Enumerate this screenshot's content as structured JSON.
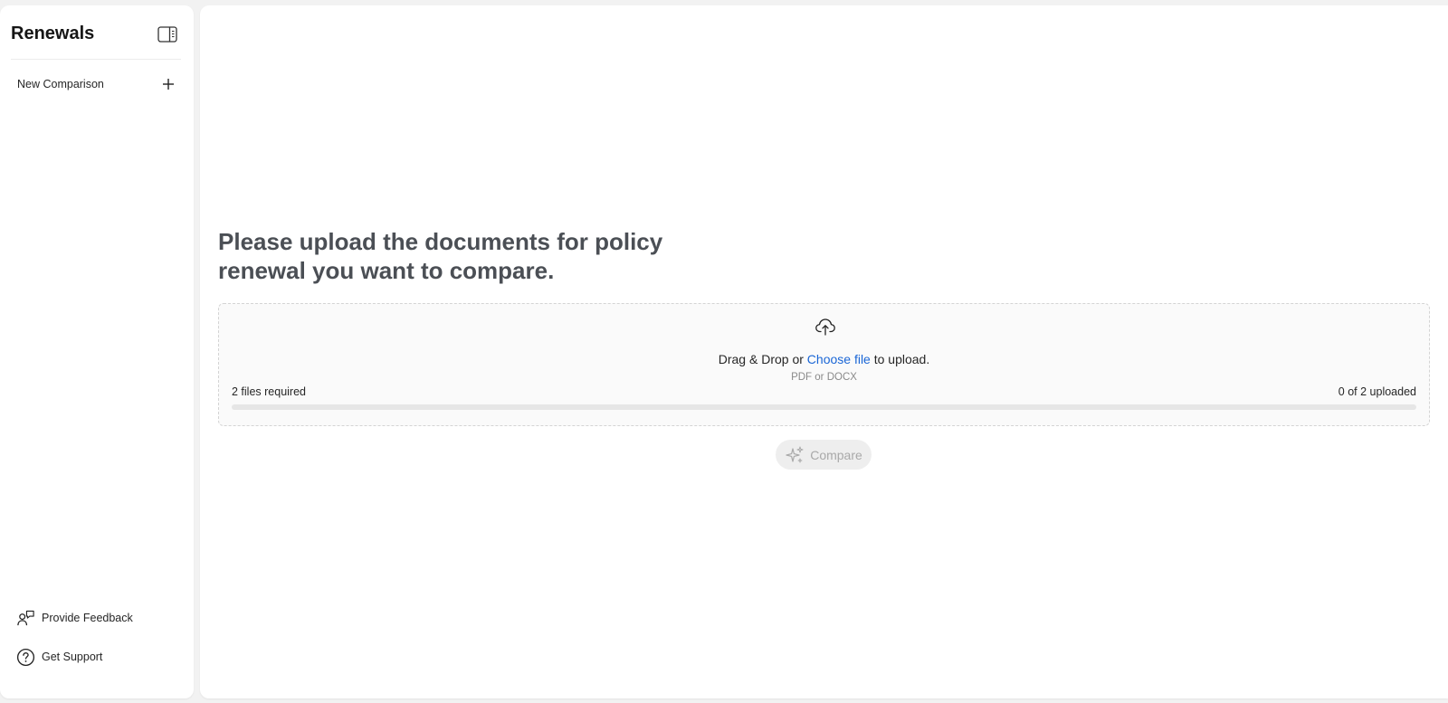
{
  "sidebar": {
    "title": "Renewals",
    "new_comparison_label": "New Comparison",
    "footer": {
      "feedback_label": "Provide Feedback",
      "support_label": "Get Support"
    }
  },
  "main": {
    "headline": "Please upload the documents for policy renewal you want to compare.",
    "dropzone": {
      "prefix": "Drag & Drop or ",
      "link": "Choose file",
      "suffix": " to upload.",
      "formats": "PDF or DOCX",
      "required": "2 files required",
      "uploaded_status": "0 of 2 uploaded",
      "progress_fraction": 0
    },
    "compare_label": "Compare"
  },
  "icons": {
    "sidebar_toggle": "sidebar-toggle-icon",
    "new": "plus-icon",
    "upload": "cloud-upload-icon",
    "feedback": "feedback-icon",
    "support": "help-circle-icon",
    "compare": "sparkles-icon"
  },
  "colors": {
    "link": "#1a66d6",
    "headline": "#4b4f55",
    "disabled_text": "#a9a9a9",
    "disabled_bg": "#eeeeee"
  }
}
